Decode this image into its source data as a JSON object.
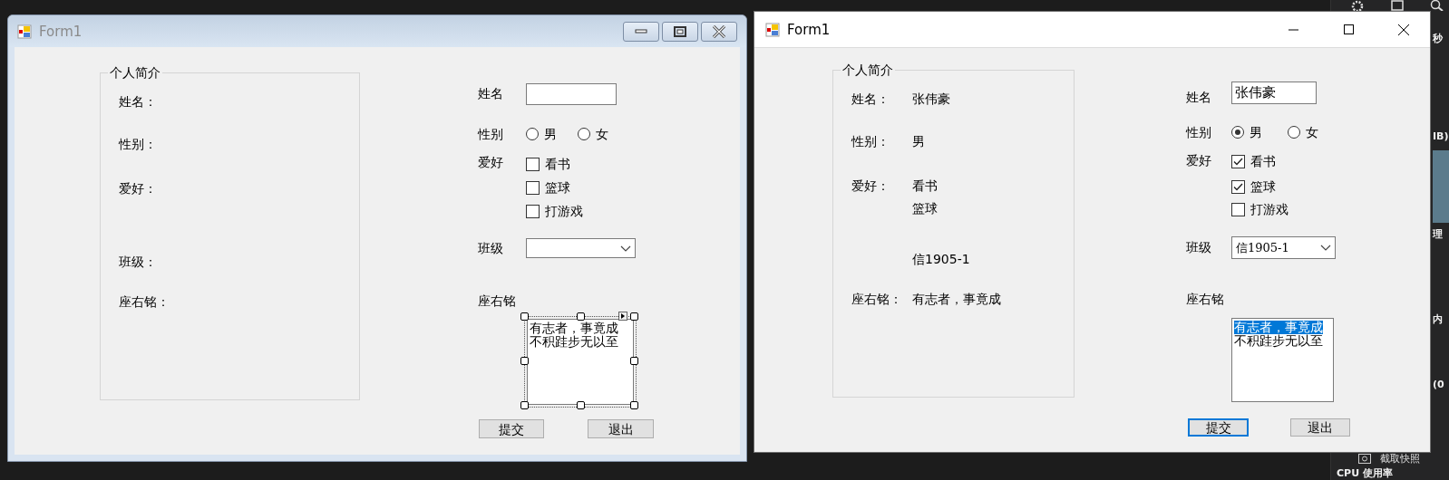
{
  "windows": [
    {
      "kind": "designer",
      "title": "Form1",
      "active": false,
      "profile": {
        "legend": "个人简介",
        "rows": [
          {
            "label": "姓名：",
            "values": []
          },
          {
            "label": "性别：",
            "values": []
          },
          {
            "label": "爱好：",
            "values": []
          },
          {
            "label": "班级：",
            "values": []
          },
          {
            "label": "座右铭：",
            "values": []
          }
        ]
      },
      "name": {
        "label": "姓名"
      },
      "gender": {
        "label": "性别",
        "options": [
          {
            "label": "男",
            "selected": false
          },
          {
            "label": "女",
            "selected": false
          }
        ]
      },
      "hobbies": {
        "label": "爱好",
        "options": [
          {
            "label": "看书",
            "checked": false
          },
          {
            "label": "篮球",
            "checked": false
          },
          {
            "label": "打游戏",
            "checked": false
          }
        ]
      },
      "class": {
        "label": "班级"
      },
      "motto": {
        "label": "座右铭",
        "designer_selected": true,
        "lines": [
          {
            "text": "有志者，事竟成",
            "selected": false
          },
          {
            "text": "不积跬步无以至",
            "selected": false
          }
        ]
      },
      "buttons": [
        {
          "label": "提交",
          "focused": false
        },
        {
          "label": "退出",
          "focused": false
        }
      ]
    },
    {
      "kind": "runtime",
      "title": "Form1",
      "active": true,
      "profile": {
        "legend": "个人简介",
        "rows": [
          {
            "label": "姓名：",
            "values": [
              "张伟豪"
            ]
          },
          {
            "label": "性别：",
            "values": [
              "男"
            ]
          },
          {
            "label": "爱好：",
            "values": [
              "看书",
              "篮球"
            ]
          },
          {
            "values": [
              "信1905-1"
            ]
          },
          {
            "label": "座右铭：",
            "values": [
              "有志者，事竟成"
            ]
          }
        ]
      },
      "name": {
        "label": "姓名",
        "value": "张伟豪"
      },
      "gender": {
        "label": "性别",
        "options": [
          {
            "label": "男",
            "selected": true
          },
          {
            "label": "女",
            "selected": false
          }
        ]
      },
      "hobbies": {
        "label": "爱好",
        "options": [
          {
            "label": "看书",
            "checked": true
          },
          {
            "label": "篮球",
            "checked": true
          },
          {
            "label": "打游戏",
            "checked": false
          }
        ]
      },
      "class": {
        "label": "班级",
        "value": "信1905-1"
      },
      "motto": {
        "label": "座右铭",
        "designer_selected": false,
        "lines": [
          {
            "text": "有志者，事竟成",
            "selected": true
          },
          {
            "text": "不积跬步无以至",
            "selected": false
          }
        ]
      },
      "buttons": [
        {
          "label": "提交",
          "focused": true
        },
        {
          "label": "退出",
          "focused": false
        }
      ]
    }
  ],
  "side_panel": {
    "labels": [
      "秒",
      "IB)",
      "理",
      "内",
      "(0"
    ],
    "snapshot_button": "截取快照",
    "heading": "CPU 使用率"
  }
}
